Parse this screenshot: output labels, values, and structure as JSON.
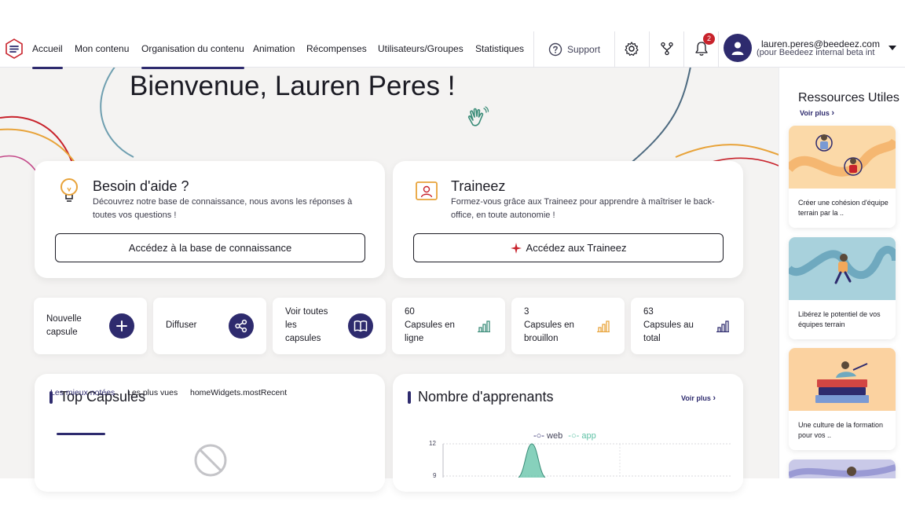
{
  "nav": {
    "items": [
      {
        "label": "Accueil",
        "active": true
      },
      {
        "label": "Mon contenu",
        "active": false
      },
      {
        "label": "Organisation du contenu",
        "active": true
      },
      {
        "label": "Animation",
        "active": false
      },
      {
        "label": "Récompenses",
        "active": false
      },
      {
        "label": "Utilisateurs/Groupes",
        "active": false
      },
      {
        "label": "Statistiques",
        "active": false
      }
    ],
    "support_label": "Support",
    "notification_count": "2",
    "user_email": "lauren.peres@beedeez.com",
    "user_org": "(pour Beedeez internal beta int",
    "icons": [
      "settings-icon",
      "branch-icon",
      "bell-icon",
      "user-avatar-icon",
      "chevron-down-icon"
    ]
  },
  "welcome": {
    "title": "Bienvenue, Lauren Peres !"
  },
  "help_card": {
    "title": "Besoin d'aide ?",
    "description": "Découvrez notre base de connaissance, nous avons les réponses à toutes vos questions !",
    "button_label": "Accédez à la base de connaissance"
  },
  "traineez_card": {
    "title": "Traineez",
    "description": "Formez-vous grâce aux Traineez pour apprendre à maîtriser le back-office, en toute autonomie !",
    "button_label": "Accédez aux Traineez"
  },
  "tiles": [
    {
      "label_lines": [
        "Nouvelle",
        "capsule"
      ],
      "icon": "plus-icon"
    },
    {
      "label_lines": [
        "Diffuser"
      ],
      "icon": "share-icon"
    },
    {
      "label_lines": [
        "Voir toutes",
        "les",
        "capsules"
      ],
      "icon": "book-icon"
    },
    {
      "label_lines": [
        "60",
        "Capsules en",
        "ligne"
      ],
      "icon": "chart-icon",
      "color": "#3a8c78"
    },
    {
      "label_lines": [
        "3",
        "Capsules en",
        "brouillon"
      ],
      "icon": "chart-icon",
      "color": "#e8a33a"
    },
    {
      "label_lines": [
        "63",
        "Capsules au",
        "total"
      ],
      "icon": "chart-icon",
      "color": "#2e2b6e"
    }
  ],
  "top_capsules": {
    "title": "Top Capsules",
    "tabs": [
      "Les mieux notées",
      "Les plus vues",
      "homeWidgets.mostRecent"
    ],
    "active_tab": 0
  },
  "learners": {
    "title": "Nombre d'apprenants",
    "voir_plus": "Voir plus",
    "legend": [
      "web",
      "app"
    ],
    "y_ticks": [
      "12",
      "9"
    ]
  },
  "resources": {
    "title": "Ressources Utiles",
    "voir_plus": "Voir plus",
    "items": [
      {
        "text": "Créer une cohésion d'équipe terrain par la ..",
        "bg": "#fbd9a8"
      },
      {
        "text": "Libérez le potentiel de vos équipes terrain",
        "bg": "#a8d1dc"
      },
      {
        "text": "Une culture de la formation pour vos ..",
        "bg": "#fbd2a0"
      },
      {
        "text": "",
        "bg": "#c9c9e8"
      }
    ]
  },
  "colors": {
    "brand": "#2e2b6e",
    "accent_red": "#c8232c",
    "green": "#3a8c78",
    "orange": "#e8a33a"
  }
}
